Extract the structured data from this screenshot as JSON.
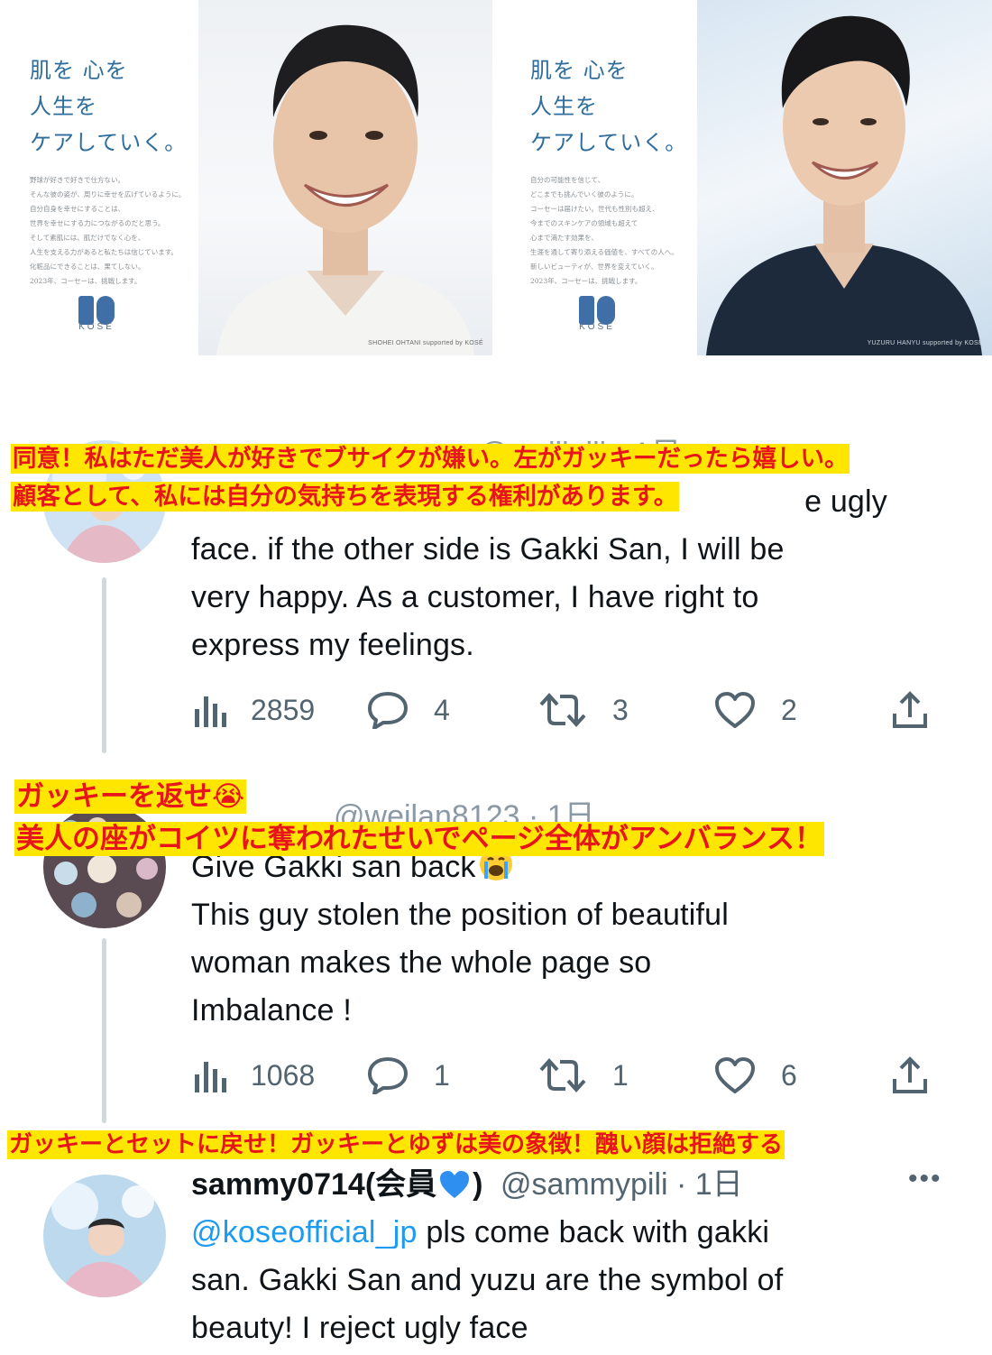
{
  "ads": [
    {
      "tagline": "肌を 心を\n人生を\nケアしていく。",
      "body": "野球が好きで好きで仕方ない。\nそんな彼の姿が、周りに幸せを広げているように。\n自分自身を幸せにすることは、\n世界を幸せにする力につながるのだと思う。\nそして素肌には、肌だけでなく心を、\n人生を支える力があると私たちは信じています。\n化粧品にできることは、果てしない。\n2023年、コーセーは、挑戦します。",
      "brand": "KOSÉ",
      "credit": "SHOHEI OHTANI supported by KOSÉ"
    },
    {
      "tagline": "肌を 心を\n人生を\nケアしていく。",
      "body": "自分の可能性を信じて、\nどこまでも挑んでいく彼のように。\nコーセーは届けたい。世代も性別も超え、\n今までのスキンケアの領域も超えて\n心まで満たす効果を、\n生涯を通して寄り添える価値を、すべての人へ。\n新しいビューティが、世界を変えていく。\n2023年、コーセーは、挑戦します。",
      "brand": "KOSÉ",
      "credit": "YUZURU HANYU supported by KOSÉ"
    }
  ],
  "tweets": [
    {
      "header_visible": "@weilipili · 1日",
      "text_lines": [
        "face. if the other side is Gakki San, I will be",
        "very happy. As a customer, I have right to",
        "express my feelings."
      ],
      "partial_line": "e ugly",
      "views": "2859",
      "replies": "4",
      "retweets": "3",
      "likes": "2"
    },
    {
      "header_visible": "@weilan8123 · 1日",
      "text_lines": [
        "Give Gakki san back",
        "This guy stolen the position of beautiful",
        "woman makes the whole page so",
        "Imbalance !"
      ],
      "views": "1068",
      "replies": "1",
      "retweets": "1",
      "likes": "6"
    },
    {
      "name": "sammy0714(会員",
      "name_close": ")",
      "handle": "@sammypili · 1日",
      "more": "•••",
      "mention": "@koseofficial_jp",
      "text_first": " pls come back with gakki",
      "text_lines": [
        "san. Gakki San and yuzu are the symbol of",
        "beauty! I reject ugly face"
      ]
    }
  ],
  "captions": [
    {
      "lines": [
        "同意！私はただ美人が好きでブサイクが嫌い。左がガッキーだったら嬉しい。",
        "顧客として、私には自分の気持ちを表現する権利があります。"
      ]
    },
    {
      "lines": [
        "ガッキーを返せ😭",
        "美人の座がコイツに奪われたせいでページ全体がアンバランス！"
      ]
    },
    {
      "lines": [
        "ガッキーとセットに戻せ！ガッキーとゆずは美の象徴！醜い顔は拒絶する"
      ]
    }
  ],
  "colors": {
    "caption_text": "#e8141b",
    "caption_highlight": "#ffe600",
    "mention": "#1d9bf0",
    "muted": "#536471",
    "tagline": "#2f6e9c"
  }
}
